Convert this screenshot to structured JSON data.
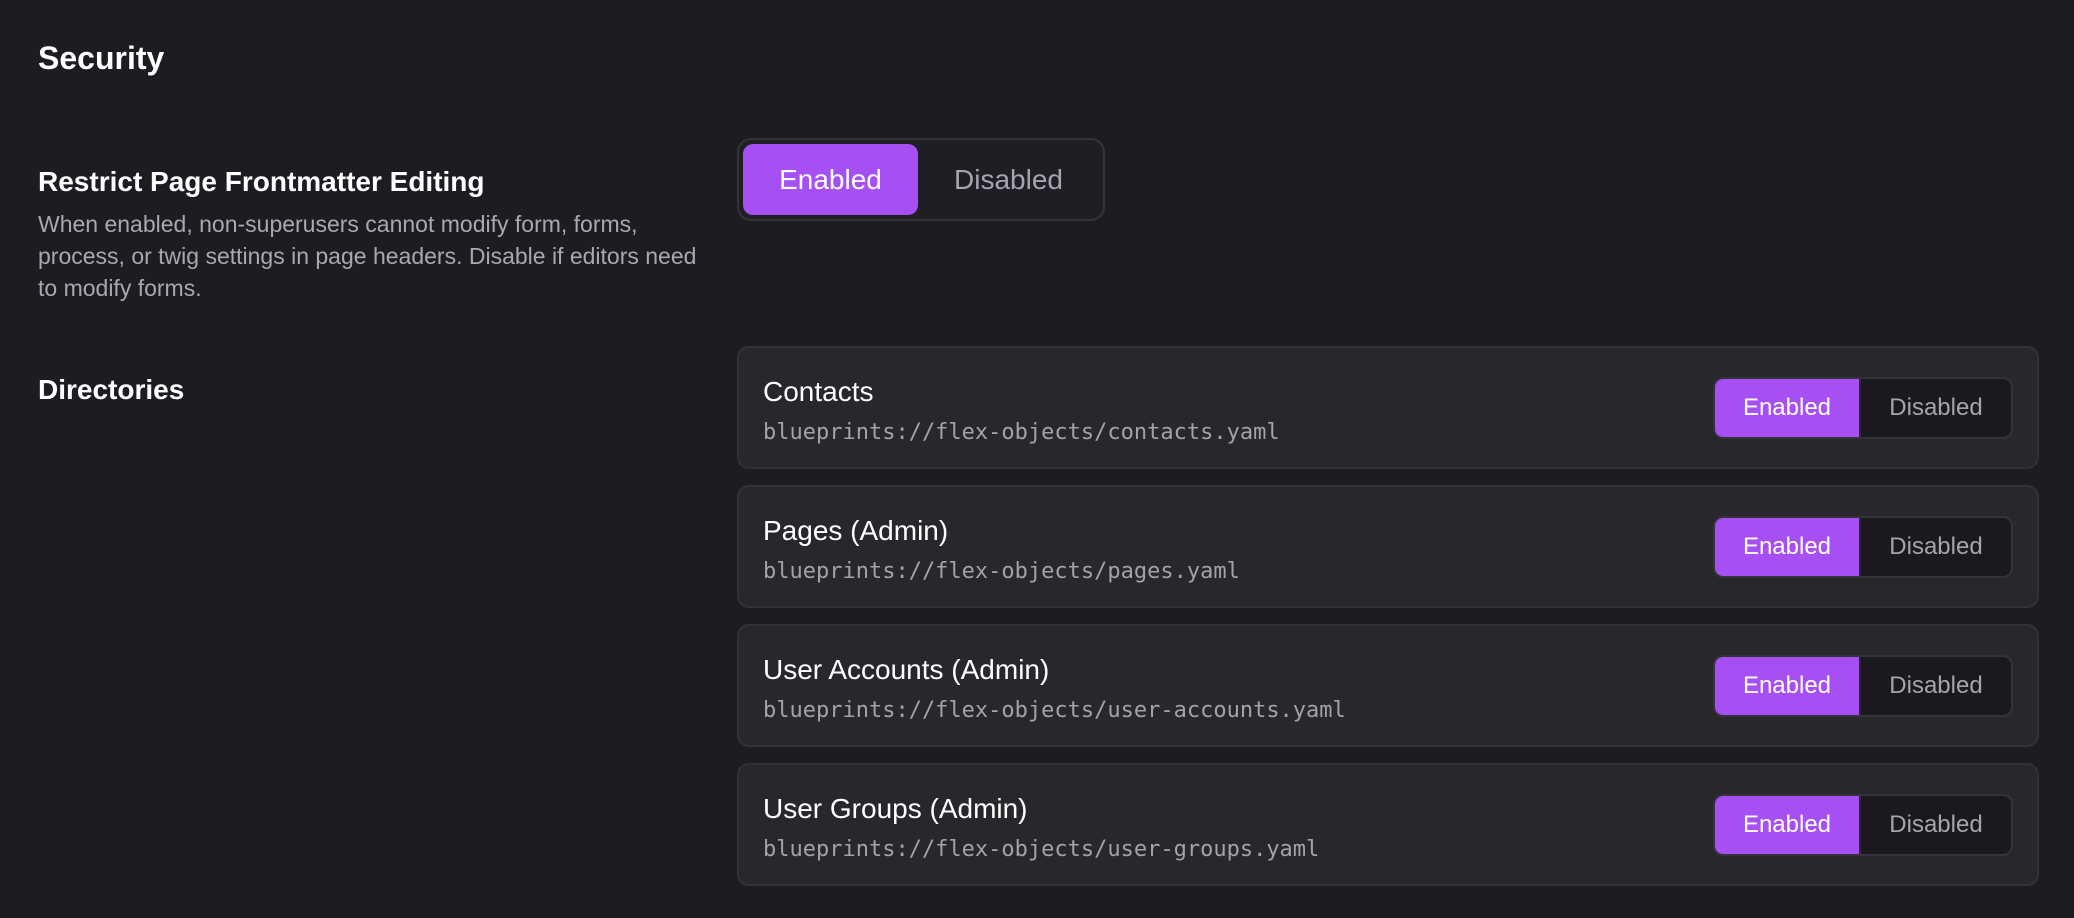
{
  "section": {
    "title": "Security"
  },
  "frontmatter": {
    "label": "Restrict Page Frontmatter Editing",
    "description": "When enabled, non-superusers cannot modify form, forms, process, or twig settings in page headers. Disable if editors need to modify forms.",
    "toggle": {
      "enabled_label": "Enabled",
      "disabled_label": "Disabled",
      "selected": "Enabled"
    }
  },
  "directories": {
    "label": "Directories",
    "items": [
      {
        "name": "Contacts",
        "path": "blueprints://flex-objects/contacts.yaml",
        "enabled_label": "Enabled",
        "disabled_label": "Disabled",
        "selected": "Enabled"
      },
      {
        "name": "Pages (Admin)",
        "path": "blueprints://flex-objects/pages.yaml",
        "enabled_label": "Enabled",
        "disabled_label": "Disabled",
        "selected": "Enabled"
      },
      {
        "name": "User Accounts (Admin)",
        "path": "blueprints://flex-objects/user-accounts.yaml",
        "enabled_label": "Enabled",
        "disabled_label": "Disabled",
        "selected": "Enabled"
      },
      {
        "name": "User Groups (Admin)",
        "path": "blueprints://flex-objects/user-groups.yaml",
        "enabled_label": "Enabled",
        "disabled_label": "Disabled",
        "selected": "Enabled"
      }
    ]
  },
  "colors": {
    "background": "#1d1c22",
    "accent": "#a64ff2",
    "card": "#28272c"
  }
}
